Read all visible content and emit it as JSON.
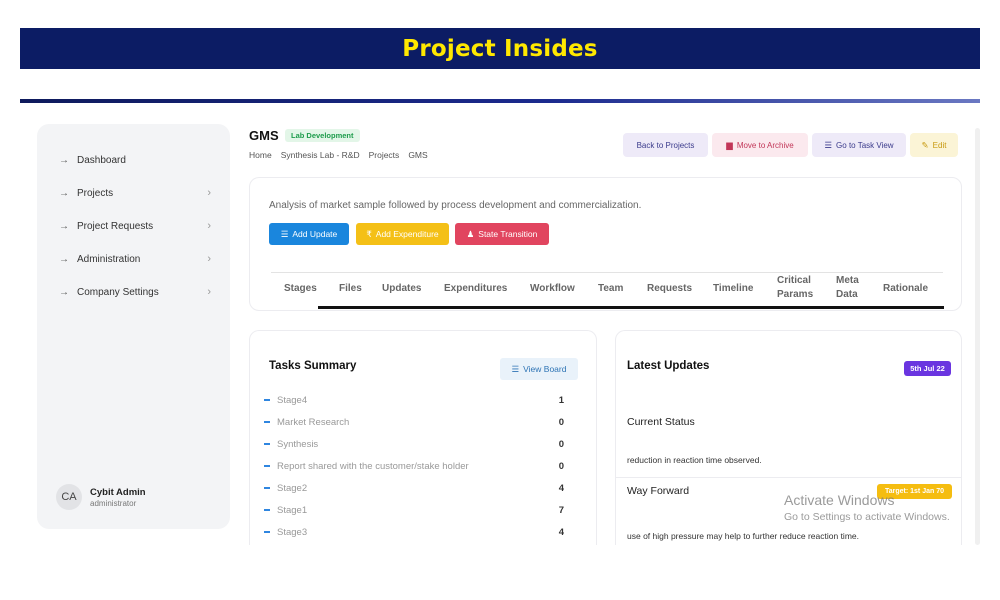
{
  "banner": {
    "title": "Project Insides"
  },
  "sidebar": {
    "items": [
      {
        "label": "Dashboard",
        "arrow": "→",
        "chevron": ""
      },
      {
        "label": "Projects",
        "arrow": "→",
        "chevron": "›"
      },
      {
        "label": "Project Requests",
        "arrow": "→",
        "chevron": "›"
      },
      {
        "label": "Administration",
        "arrow": "→",
        "chevron": "›"
      },
      {
        "label": "Company Settings",
        "arrow": "→",
        "chevron": "›"
      }
    ],
    "user": {
      "initials": "CA",
      "name": "Cybit Admin",
      "role": "administrator"
    }
  },
  "project": {
    "title": "GMS",
    "badge": "Lab Development",
    "breadcrumb": [
      "Home",
      "Synthesis Lab - R&D",
      "Projects",
      "GMS"
    ],
    "description": "Analysis of market sample followed by process development and commercialization."
  },
  "header_buttons": {
    "back": "Back to Projects",
    "archive": "Move to Archive",
    "task_view": "Go to Task View",
    "edit": "Edit"
  },
  "actions": {
    "add_update": "Add Update",
    "add_expenditure": "Add Expenditure",
    "state_transition": "State Transition"
  },
  "tabs": [
    {
      "line1": "Stages",
      "line2": ""
    },
    {
      "line1": "Files",
      "line2": ""
    },
    {
      "line1": "Updates",
      "line2": ""
    },
    {
      "line1": "Expenditures",
      "line2": ""
    },
    {
      "line1": "Workflow",
      "line2": ""
    },
    {
      "line1": "Team",
      "line2": ""
    },
    {
      "line1": "Requests",
      "line2": ""
    },
    {
      "line1": "Timeline",
      "line2": ""
    },
    {
      "line1": "Critical",
      "line2": "Params"
    },
    {
      "line1": "Meta",
      "line2": "Data"
    },
    {
      "line1": "Rationale",
      "line2": ""
    }
  ],
  "tasks": {
    "title": "Tasks Summary",
    "view_board": "View Board",
    "rows": [
      {
        "name": "Stage4",
        "count": "1"
      },
      {
        "name": "Market Research",
        "count": "0"
      },
      {
        "name": "Synthesis",
        "count": "0"
      },
      {
        "name": "Report shared with the customer/stake holder",
        "count": "0"
      },
      {
        "name": "Stage2",
        "count": "4"
      },
      {
        "name": "Stage1",
        "count": "7"
      },
      {
        "name": "Stage3",
        "count": "4"
      }
    ]
  },
  "updates": {
    "title": "Latest Updates",
    "date": "5th Jul 22",
    "current_status_label": "Current Status",
    "current_status_text": "reduction in reaction time observed.",
    "way_forward_label": "Way Forward",
    "target": "Target: 1st Jan 70",
    "way_forward_text": "use of high pressure may help to further reduce reaction time."
  },
  "watermark": {
    "line1": "Activate Windows",
    "line2": "Go to Settings to activate Windows."
  },
  "icons": {
    "add_update": "☰",
    "add_expenditure": "₹",
    "state_transition": "♟",
    "archive": "▆",
    "task_view": "☰",
    "edit": "✎",
    "view_board": "☰"
  },
  "colors": {
    "banner_bg": "#0c1c64",
    "banner_text": "#ffe800",
    "primary_blue": "#1a86dd",
    "warning_yellow": "#f4c017",
    "danger_red": "#e1455f",
    "badge_purple": "#6a35e0"
  }
}
